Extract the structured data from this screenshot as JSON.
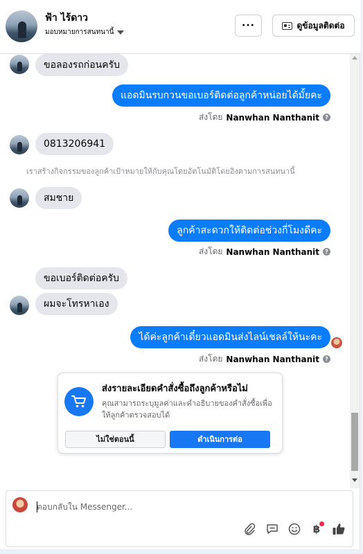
{
  "header": {
    "contact_name": "ฟ้า ไร้ดาว",
    "assign_label": "มอบหมายการสนทนานี้",
    "more_label": "···",
    "contact_info_label": "ดูข้อมูลติดต่อ"
  },
  "messages": [
    {
      "side": "in",
      "text": "ขอลองรถก่อนครับ"
    },
    {
      "side": "out",
      "text": "แอดมินรบกวนขอเบอร์ติดต่อลูกค้าหน่อยได้มั้ยคะ"
    },
    {
      "side": "in",
      "text": "0813206941"
    },
    {
      "side": "in",
      "text": "สมชาย"
    },
    {
      "side": "out",
      "text": "ลูกค้าสะดวกให้ติดต่อช่วงกี่โมงดีคะ"
    },
    {
      "side": "in",
      "text": "ขอเบอร์ติดต่อครับ"
    },
    {
      "side": "in",
      "text": "ผมจะโทรหาเอง"
    },
    {
      "side": "out",
      "text": "ได้ค่ะลูกค้าเดี๋ยวแอดมินส่งไลน์เชลล์ให้นะคะ"
    }
  ],
  "sent_by_prefix": "ส่งโดย",
  "sender_name": "Nanwhan Nanthanit",
  "system_note": "เราสร้างกิจกรรมของลูกค้าเป้าหมายให้กับคุณโดยอัตโนมัติโดยอิงตามการสนทนานี้",
  "order_card": {
    "title": "ส่งรายละเอียดคำสั่งซื้อถึงลูกค้าหรือไม่",
    "description": "คุณสามารถระบุมูลค่าและคำอธิบายของคำสั่งซื้อเพื่อให้ลูกค้าตรวจสอบได้",
    "decline_label": "ไม่ใช่ตอนนี้",
    "accept_label": "ดำเนินการต่อ"
  },
  "composer": {
    "placeholder": "ตอบกลับใน Messenger..."
  },
  "colors": {
    "outgoing_bubble": "#0a7cff",
    "incoming_bubble": "#e4e6eb",
    "accent": "#1877f2"
  }
}
